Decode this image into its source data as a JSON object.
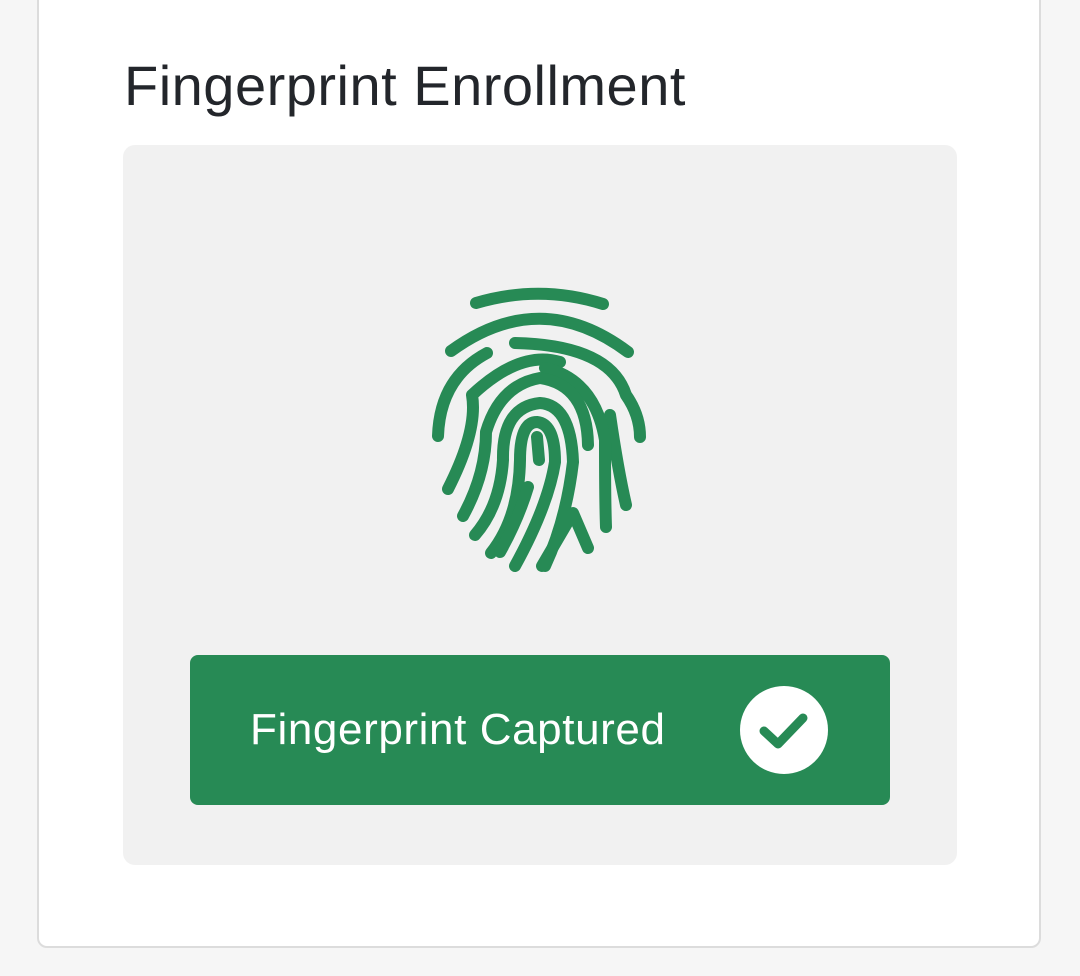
{
  "enrollment": {
    "title": "Fingerprint Enrollment",
    "status_label": "Fingerprint Captured",
    "status": "captured"
  },
  "icons": {
    "fingerprint": "fingerprint-icon",
    "check": "check-circle-icon"
  },
  "colors": {
    "accent": "#278a55",
    "title_text": "#23262b",
    "panel_bg": "#f1f1f1",
    "page_bg": "#f6f6f6",
    "card_bg": "#ffffff"
  }
}
